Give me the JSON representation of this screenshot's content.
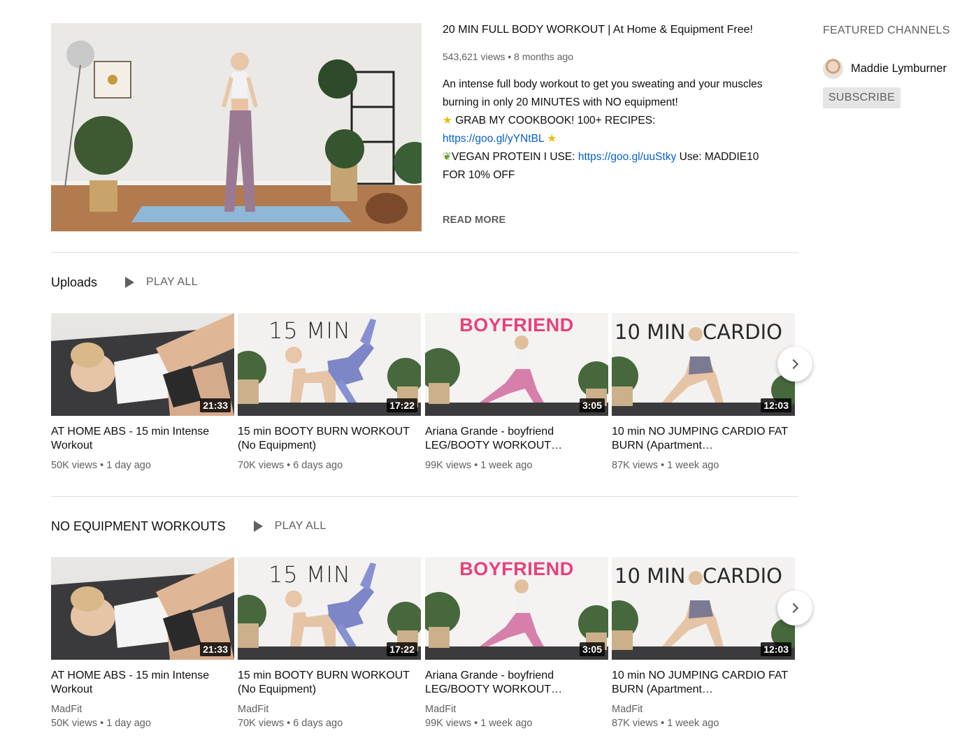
{
  "featured": {
    "title": "20 MIN FULL BODY WORKOUT | At Home & Equipment Free!",
    "meta": "543,621 views • 8 months ago",
    "desc_line1": "An intense full body workout to get you sweating and your muscles burning in only 20 MINUTES with NO equipment!",
    "desc_line2": "GRAB MY COOKBOOK! 100+ RECIPES:",
    "desc_link1": "https://goo.gl/yYNtBL",
    "desc_line3": "VEGAN PROTEIN I USE:",
    "desc_link2": "https://goo.gl/uuStky",
    "desc_line4": "Use: MADDIE10 FOR 10% OFF",
    "read_more": "READ MORE"
  },
  "sidebar": {
    "title": "FEATURED CHANNELS",
    "channel_name": "Maddie Lymburner",
    "subscribe_label": "SUBSCRIBE"
  },
  "shelves": [
    {
      "title": "Uploads",
      "play_all": "PLAY ALL",
      "videos": [
        {
          "title": "AT HOME ABS - 15 min Intense Workout",
          "duration": "21:33",
          "meta": "50K views • 1 day ago"
        },
        {
          "title": "15 min BOOTY BURN WORKOUT (No Equipment)",
          "duration": "17:22",
          "meta": "70K views • 6 days ago",
          "thumb_text": "15 MIN"
        },
        {
          "title": "Ariana Grande - boyfriend LEG/BOOTY WORKOUT…",
          "duration": "3:05",
          "meta": "99K views • 1 week ago",
          "thumb_text": "BOYFRIEND"
        },
        {
          "title": "10 min NO JUMPING CARDIO FAT BURN (Apartment…",
          "duration": "12:03",
          "meta": "87K views • 1 week ago",
          "thumb_text_left": "10 MIN",
          "thumb_text_right": "CARDIO"
        }
      ]
    },
    {
      "title": "NO EQUIPMENT WORKOUTS",
      "play_all": "PLAY ALL",
      "videos": [
        {
          "title": "AT HOME ABS - 15 min Intense Workout",
          "duration": "21:33",
          "channel": "MadFit",
          "meta": "50K views • 1 day ago"
        },
        {
          "title": "15 min BOOTY BURN WORKOUT (No Equipment)",
          "duration": "17:22",
          "channel": "MadFit",
          "meta": "70K views • 6 days ago",
          "thumb_text": "15 MIN"
        },
        {
          "title": "Ariana Grande - boyfriend LEG/BOOTY WORKOUT…",
          "duration": "3:05",
          "channel": "MadFit",
          "meta": "99K views • 1 week ago",
          "thumb_text": "BOYFRIEND"
        },
        {
          "title": "10 min NO JUMPING CARDIO FAT BURN (Apartment…",
          "duration": "12:03",
          "channel": "MadFit",
          "meta": "87K views • 1 week ago",
          "thumb_text_left": "10 MIN",
          "thumb_text_right": "CARDIO"
        }
      ]
    }
  ],
  "colors": {
    "link": "#065fd4",
    "secondary_text": "#606060",
    "boyfriend_pink": "#e8417a"
  }
}
